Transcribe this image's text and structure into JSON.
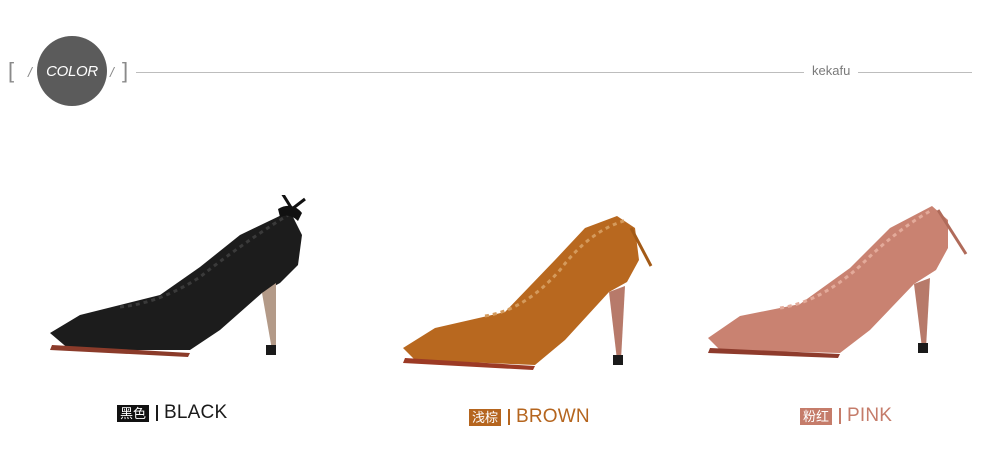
{
  "header": {
    "badge_label": "COLOR",
    "brand": "kekafu"
  },
  "products": [
    {
      "cn_label": "黑色",
      "en_label": "BLACK",
      "color_tag_bg": "#111111",
      "text_color": "#1a1a1a",
      "shoe_color": "#1c1c1c",
      "shoe_shade": "#0e0e0e"
    },
    {
      "cn_label": "浅棕",
      "en_label": "BROWN",
      "color_tag_bg": "#b5651e",
      "text_color": "#b5651e",
      "shoe_color": "#b8681f",
      "shoe_shade": "#8d4c12"
    },
    {
      "cn_label": "粉红",
      "en_label": "PINK",
      "color_tag_bg": "#c57c6a",
      "text_color": "#c57c6a",
      "shoe_color": "#c98271",
      "shoe_shade": "#a4604f"
    }
  ]
}
